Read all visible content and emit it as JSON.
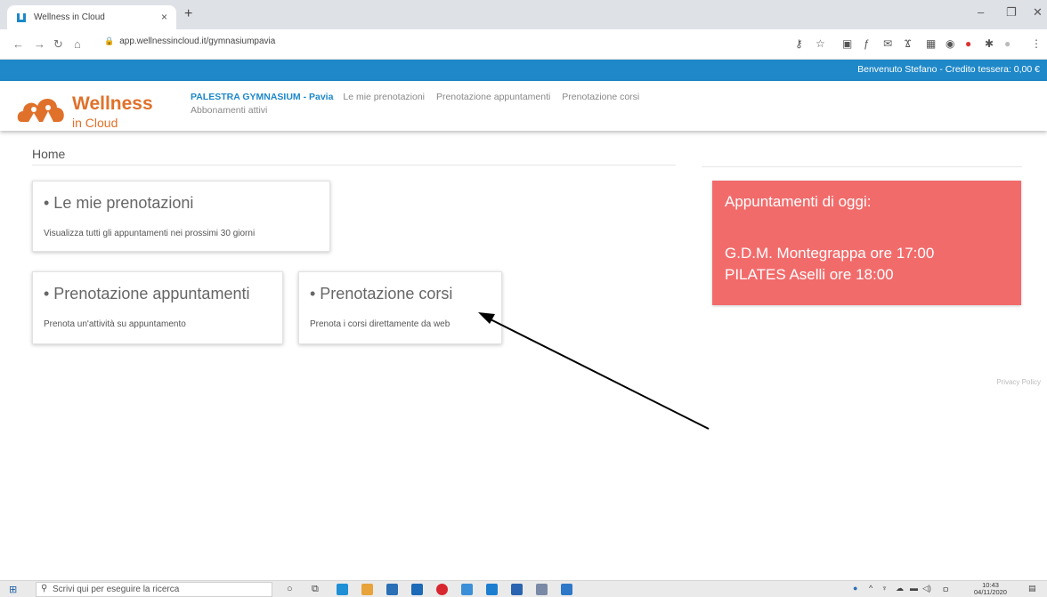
{
  "browser": {
    "tab_title": "Wellness in Cloud",
    "tab_close": "×",
    "new_tab": "+",
    "url": "app.wellnessincloud.it/gymnasiumpavia",
    "win_min": "–",
    "win_max": "❐",
    "win_close": "✕"
  },
  "site": {
    "welcome": "Benvenuto Stefano  -  Credito tessera: 0,00 €",
    "logo_main": "Wellness",
    "logo_sub": "in Cloud",
    "gym_name": "PALESTRA GYMNASIUM - Pavia",
    "nav": [
      "Le mie prenotazioni",
      "Prenotazione appuntamenti",
      "Prenotazione corsi"
    ],
    "nav2": "Abbonamenti attivi",
    "accent": "#1e88c8",
    "brand": "#e0712a"
  },
  "breadcrumb": "Home",
  "cards": [
    {
      "title": "• Le mie prenotazioni",
      "desc": "Visualizza tutti gli appuntamenti nei prossimi 30 giorni"
    },
    {
      "title": "• Prenotazione appuntamenti",
      "desc": "Prenota un'attività su appuntamento"
    },
    {
      "title": "• Prenotazione corsi",
      "desc": "Prenota i corsi direttamente da web"
    }
  ],
  "today": {
    "title": "Appuntamenti di oggi:",
    "appointments": [
      "G.D.M. Montegrappa ore 17:00",
      "PILATES Aselli ore 18:00"
    ],
    "color": "#f26b6b"
  },
  "privacy": "Privacy Policy",
  "taskbar": {
    "search_placeholder": "Scrivi qui per eseguire la ricerca",
    "time": "10:43",
    "date": "04/11/2020"
  }
}
